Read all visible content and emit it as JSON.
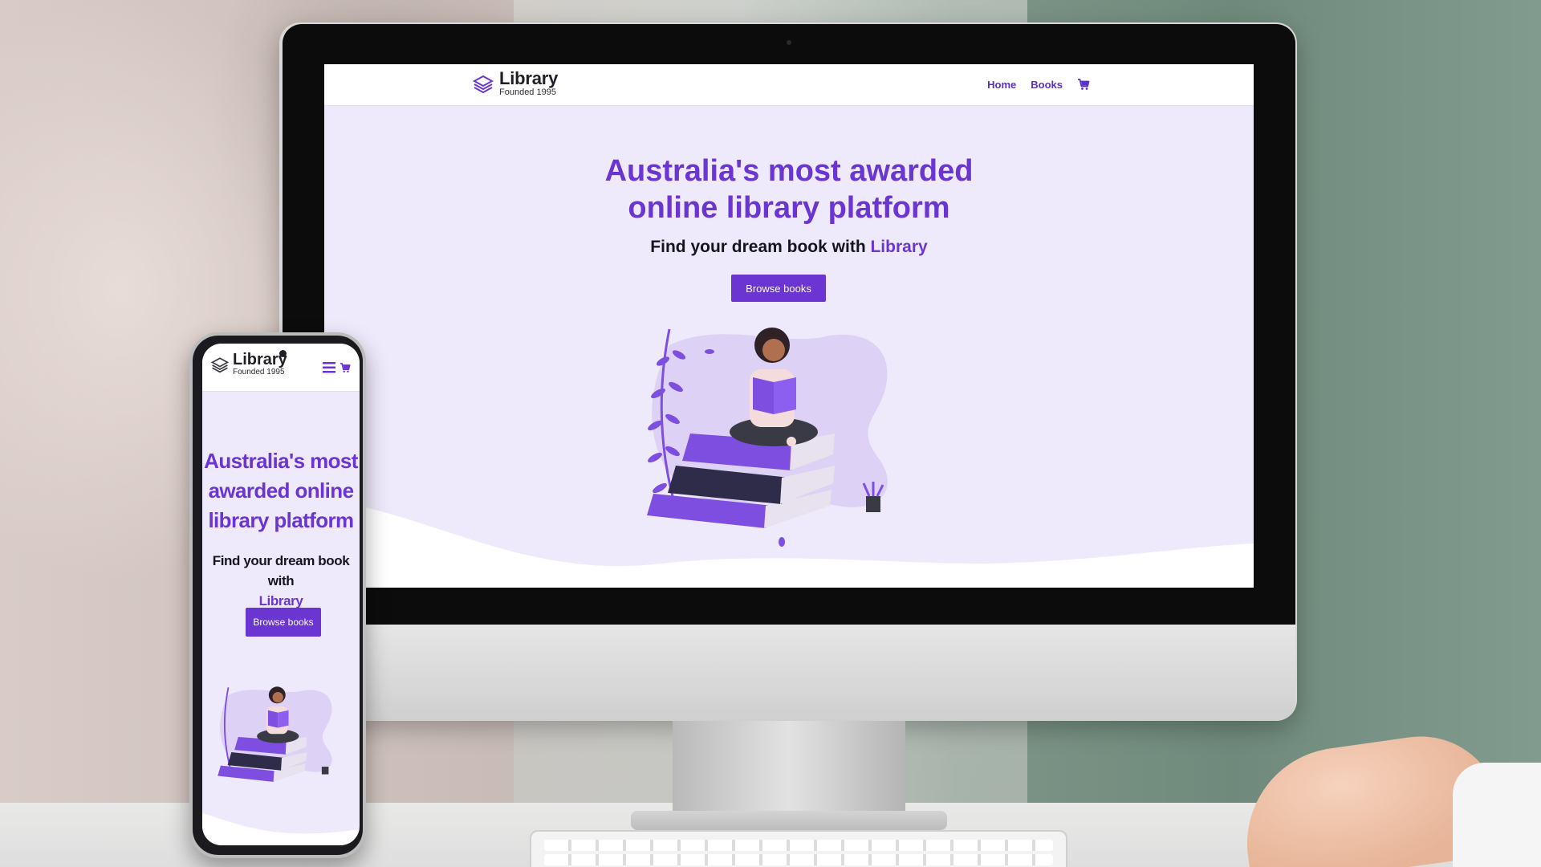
{
  "site": {
    "logo_title": "Library",
    "logo_subtitle": "Founded 1995",
    "nav": {
      "home": "Home",
      "books": "Books"
    },
    "hero": {
      "headline_line1": "Australia's most awarded",
      "headline_line2": "online library platform",
      "subheadline_prefix": "Find your dream book with ",
      "subheadline_accent": "Library",
      "cta_label": "Browse books"
    }
  },
  "phone": {
    "headline_line1": "Australia's most",
    "headline_line2": "awarded online",
    "headline_line3": "library platform",
    "subheadline_line1": "Find your dream book with",
    "subheadline_accent": "Library"
  },
  "icons": [
    "library-logo-icon",
    "cart-icon",
    "hamburger-menu-icon"
  ],
  "colors": {
    "brand": "#6a35d1",
    "hero_bg": "#efeafb",
    "text_dark": "#15151c"
  }
}
